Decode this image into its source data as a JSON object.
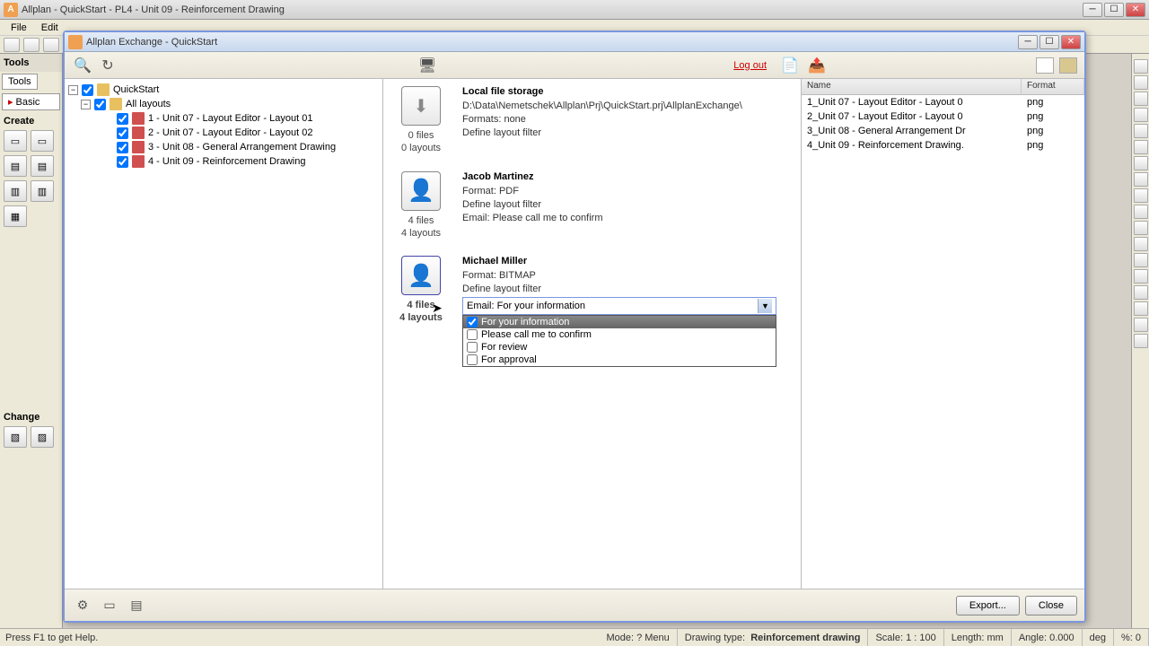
{
  "app": {
    "title": "Allplan - QuickStart - PL4 - Unit 09 - Reinforcement Drawing",
    "icon_letter": "A"
  },
  "menubar": {
    "file": "File",
    "edit": "Edit"
  },
  "left_tools": {
    "panel_title": "Tools",
    "tab_tools": "Tools",
    "tab_basic": "Basic",
    "section_create": "Create",
    "section_change": "Change"
  },
  "exchange": {
    "title": "Allplan Exchange - QuickStart",
    "logout": "Log out",
    "tree": {
      "root": "QuickStart",
      "all_layouts": "All layouts",
      "items": [
        "1 - Unit 07 - Layout Editor - Layout 01",
        "2 - Unit 07 - Layout Editor - Layout 02",
        "3 - Unit 08 - General Arrangement Drawing",
        "4 - Unit 09 - Reinforcement Drawing"
      ]
    },
    "recipients": [
      {
        "name": "Local file storage",
        "line1": "D:\\Data\\Nemetschek\\Allplan\\Prj\\QuickStart.prj\\AllplanExchange\\",
        "line2": "Formats: none",
        "line3": "Define layout filter",
        "files": "0 files",
        "layouts": "0 layouts",
        "type": "storage"
      },
      {
        "name": "Jacob Martinez",
        "line1": "Format: PDF",
        "line2": "Define layout filter",
        "line3": "Email: Please call me to confirm",
        "files": "4 files",
        "layouts": "4 layouts",
        "type": "person"
      },
      {
        "name": "Michael Miller",
        "line1": "Format: BITMAP",
        "line2": "Define layout filter",
        "files": "4 files",
        "layouts": "4 layouts",
        "type": "person"
      }
    ],
    "email_combo": {
      "label": "Email: For your information",
      "selected": "For your information",
      "options": [
        "Please call me to confirm",
        "For review",
        "For approval"
      ]
    },
    "files": {
      "col_name": "Name",
      "col_format": "Format",
      "rows": [
        {
          "name": "1_Unit 07 - Layout Editor - Layout 0",
          "fmt": "png"
        },
        {
          "name": "2_Unit 07 - Layout Editor - Layout 0",
          "fmt": "png"
        },
        {
          "name": "3_Unit 08 - General Arrangement Dr",
          "fmt": "png"
        },
        {
          "name": "4_Unit 09 - Reinforcement Drawing.",
          "fmt": "png"
        }
      ]
    },
    "footer": {
      "export": "Export...",
      "close": "Close"
    }
  },
  "statusbar": {
    "help": "Press F1 to get Help.",
    "mode_label": "Mode:",
    "mode_value": "? Menu",
    "drawtype_label": "Drawing type:",
    "drawtype_value": "Reinforcement drawing",
    "scale_label": "Scale:",
    "scale_value": "1 : 100",
    "length_label": "Length:",
    "length_value": "mm",
    "angle_label": "Angle:",
    "angle_value": "0.000",
    "angle_unit": "deg",
    "pct_label": "%:",
    "pct_value": "0"
  }
}
